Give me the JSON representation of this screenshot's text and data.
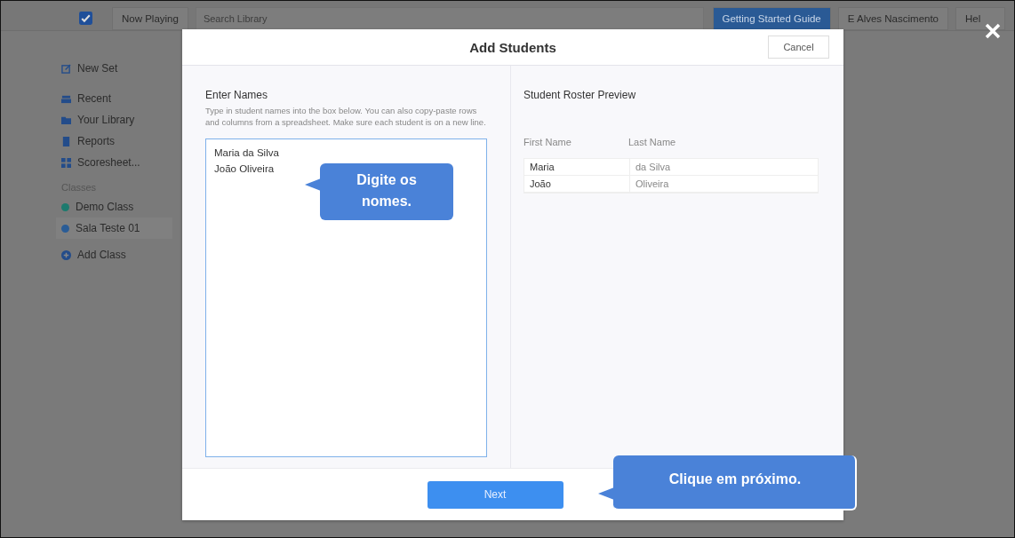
{
  "top_bar": {
    "now_playing": "Now Playing",
    "search": {
      "placeholder": "Search Library"
    },
    "guide_button": "Getting Started Guide",
    "user": "E Alves Nascimento",
    "help": "Hel"
  },
  "sidebar": {
    "new_set": "New Set",
    "items": [
      {
        "label": "Recent",
        "kind": "recent"
      },
      {
        "label": "Your Library",
        "kind": "folder"
      },
      {
        "label": "Reports",
        "kind": "reports"
      },
      {
        "label": "Scoresheet...",
        "kind": "grid"
      }
    ],
    "classes_heading": "Classes",
    "classes": [
      {
        "label": "Demo Class",
        "color": "#1d7a6e",
        "selected": false
      },
      {
        "label": "Sala Teste 01",
        "color": "#2a5c96",
        "selected": true
      }
    ],
    "add_class": "Add Class"
  },
  "dialog": {
    "title": "Add Students",
    "cancel": "Cancel",
    "enter_names": {
      "heading": "Enter Names",
      "hint": "Type in student names into the box below. You can also copy-paste rows and columns from a spreadsheet. Make sure each student is on a new line.",
      "value": "Maria da Silva\nJoão Oliveira"
    },
    "preview": {
      "heading": "Student Roster Preview",
      "columns": [
        "First Name",
        "Last Name"
      ],
      "rows": [
        [
          "Maria",
          "da Silva"
        ],
        [
          "João",
          "Oliveira"
        ]
      ]
    },
    "next": "Next"
  },
  "callouts": [
    "Digite os nomes.",
    "Clique em próximo."
  ]
}
